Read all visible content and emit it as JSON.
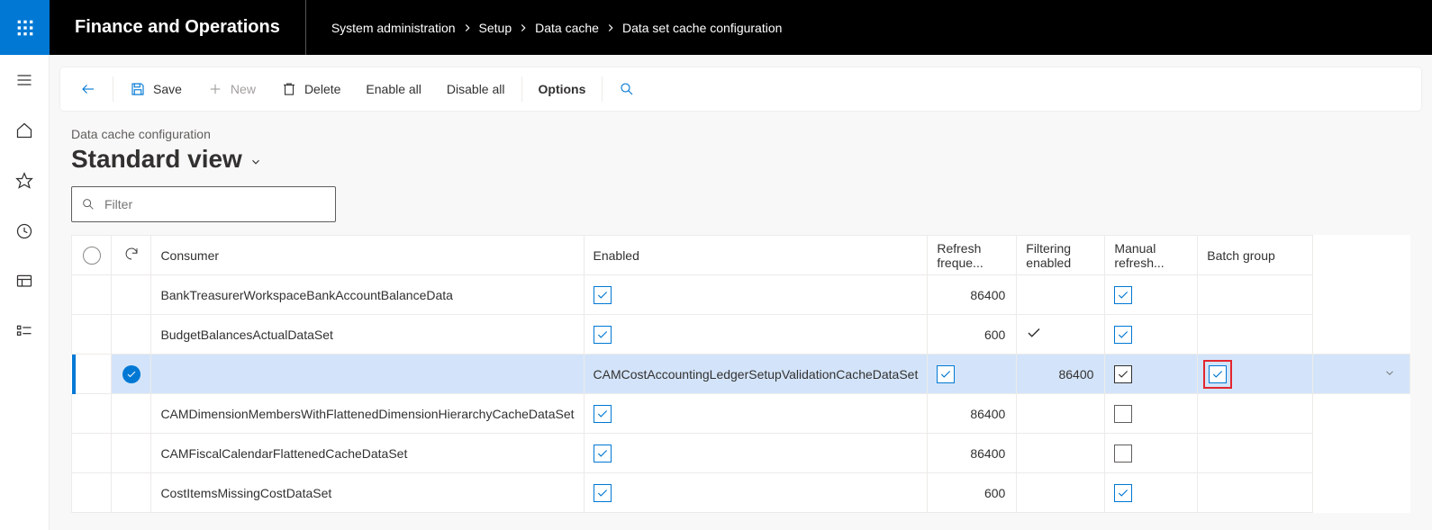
{
  "app": {
    "name": "Finance and Operations"
  },
  "breadcrumb": [
    "System administration",
    "Setup",
    "Data cache",
    "Data set cache configuration"
  ],
  "actions": {
    "save": "Save",
    "new": "New",
    "delete": "Delete",
    "enable_all": "Enable all",
    "disable_all": "Disable all",
    "options": "Options"
  },
  "page": {
    "subtitle": "Data cache configuration",
    "view_name": "Standard view",
    "filter_placeholder": "Filter"
  },
  "columns": {
    "consumer": "Consumer",
    "enabled": "Enabled",
    "refresh_freq": "Refresh freque...",
    "filtering": "Filtering enabled",
    "manual": "Manual refresh...",
    "batch": "Batch group"
  },
  "rows": [
    {
      "consumer": "BankTreasurerWorkspaceBankAccountBalanceData",
      "enabled": true,
      "freq": "86400",
      "filtering": "",
      "manual": true,
      "selected": false,
      "batch": ""
    },
    {
      "consumer": "BudgetBalancesActualDataSet",
      "enabled": true,
      "freq": "600",
      "filtering": "check",
      "manual": true,
      "selected": false,
      "batch": ""
    },
    {
      "consumer": "CAMCostAccountingLedgerSetupValidationCacheDataSet",
      "enabled": true,
      "freq": "86400",
      "filtering": "box",
      "manual": true,
      "selected": true,
      "highlight": true,
      "batch": ""
    },
    {
      "consumer": "CAMDimensionMembersWithFlattenedDimensionHierarchyCacheDataSet",
      "enabled": true,
      "freq": "86400",
      "filtering": "",
      "manual": false,
      "selected": false,
      "batch": ""
    },
    {
      "consumer": "CAMFiscalCalendarFlattenedCacheDataSet",
      "enabled": true,
      "freq": "86400",
      "filtering": "",
      "manual": false,
      "selected": false,
      "batch": ""
    },
    {
      "consumer": "CostItemsMissingCostDataSet",
      "enabled": true,
      "freq": "600",
      "filtering": "",
      "manual": true,
      "selected": false,
      "batch": ""
    }
  ]
}
